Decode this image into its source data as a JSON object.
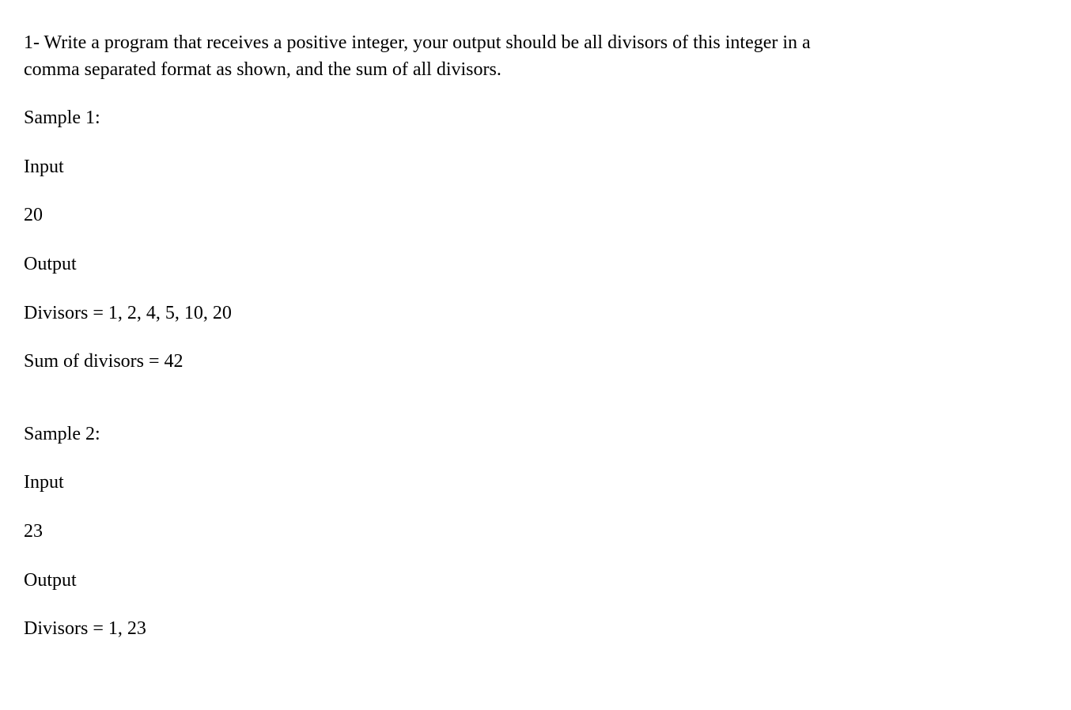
{
  "problem": {
    "statement": "1- Write a program that receives a positive integer, your output should be all divisors of this integer in a comma separated format as shown, and the sum of all divisors."
  },
  "samples": [
    {
      "title": "Sample 1:",
      "input_label": "Input",
      "input_value": "20",
      "output_label": "Output",
      "divisors_line": "Divisors = 1, 2, 4, 5, 10, 20",
      "sum_line": "Sum of divisors = 42"
    },
    {
      "title": "Sample 2:",
      "input_label": "Input",
      "input_value": "23",
      "output_label": "Output",
      "divisors_line": "Divisors = 1, 23",
      "sum_line": ""
    }
  ]
}
